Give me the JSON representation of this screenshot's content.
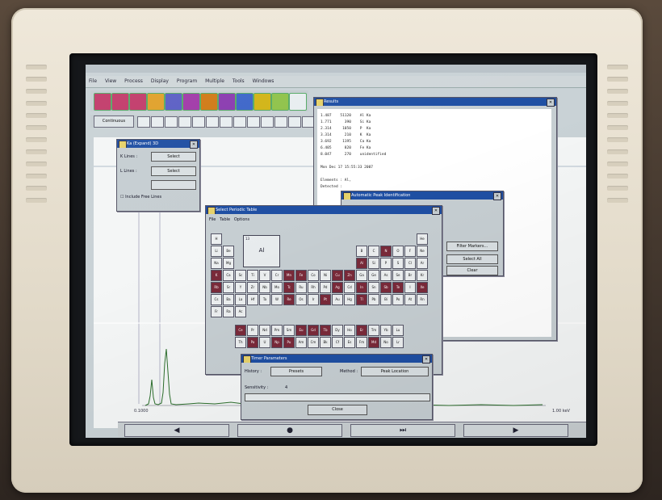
{
  "menu": [
    "File",
    "View",
    "Process",
    "Display",
    "Program",
    "Multiple",
    "Tools",
    "Windows"
  ],
  "toolbar": {
    "button_colors": [
      "#c23b6a",
      "#c23b6a",
      "#c23b6a",
      "#e0a12a",
      "#5b5fc4",
      "#a13aa8",
      "#d07a16",
      "#8a3bb0",
      "#3d66c9",
      "#d2b416",
      "#8fc24a",
      "#e8eef0"
    ],
    "control_label": "Continuous"
  },
  "results": {
    "title": "Results",
    "lines": [
      "1.487    51120    Al Ka",
      "1.771      390    Si Ka",
      "2.314     1050    P  Ka",
      "3.314      210    K  Ka",
      "3.692     1195    Ca Ka",
      "6.405      820    Fe Ka",
      "8.047      270    unidentified",
      "",
      "Mon Dec 17 15:55:33 2007",
      "",
      "Elements : Al,",
      "Detected :"
    ]
  },
  "ka_dialog": {
    "title": "Ka (Expand) 3D",
    "lines_label_1": "K Lines :",
    "lines_label_2": "L Lines :",
    "select_1": "Select",
    "select_2": "Select",
    "checkbox_label": "Include Free Lines"
  },
  "auto_peak": {
    "title": "Automatic Peak Identification",
    "buttons": [
      "Filter Markers...",
      "Select All",
      "Clear"
    ]
  },
  "periodic": {
    "title": "Select Periodic Table",
    "menu": [
      "File",
      "Table",
      "Options"
    ],
    "selected_number": "13",
    "selected_symbol": "Al",
    "elements": [
      "H",
      "He",
      "Li",
      "Be",
      "B",
      "C",
      "N",
      "O",
      "F",
      "Ne",
      "Na",
      "Mg",
      "Al",
      "Si",
      "P",
      "S",
      "Cl",
      "Ar",
      "K",
      "Ca",
      "Sc",
      "Ti",
      "V",
      "Cr",
      "Mn",
      "Fe",
      "Co",
      "Ni",
      "Cu",
      "Zn",
      "Ga",
      "Ge",
      "As",
      "Se",
      "Br",
      "Kr",
      "Rb",
      "Sr",
      "Y",
      "Zr",
      "Nb",
      "Mo",
      "Tc",
      "Ru",
      "Rh",
      "Pd",
      "Ag",
      "Cd",
      "In",
      "Sn",
      "Sb",
      "Te",
      "I",
      "Xe",
      "Cs",
      "Ba",
      "La",
      "Hf",
      "Ta",
      "W",
      "Re",
      "Os",
      "Ir",
      "Pt",
      "Au",
      "Hg",
      "Tl",
      "Pb",
      "Bi",
      "Po",
      "At",
      "Rn",
      "Fr",
      "Ra",
      "Ac",
      "Ce",
      "Pr",
      "Nd",
      "Pm",
      "Sm",
      "Eu",
      "Gd",
      "Tb",
      "Dy",
      "Ho",
      "Er",
      "Tm",
      "Yb",
      "Lu",
      "Th",
      "Pa",
      "U",
      "Np",
      "Pu",
      "Am",
      "Cm",
      "Bk",
      "Cf",
      "Es",
      "Fm",
      "Md",
      "No",
      "Lr"
    ],
    "highlighted": [
      "N",
      "Al",
      "K",
      "Mn",
      "Fe",
      "Cu",
      "Zn",
      "Rb",
      "Tc",
      "Ag",
      "In",
      "Sb",
      "Te",
      "Xe",
      "Re",
      "Pt",
      "Tl",
      "Ce",
      "Eu",
      "Gd",
      "Tb",
      "Er",
      "Pa",
      "Np",
      "Pu",
      "Md"
    ]
  },
  "timer_parameters": {
    "title": "Timer Parameters",
    "history_label": "History :",
    "history_value": "Presets",
    "method_label": "Method :",
    "method_value": "Peak Location",
    "sensitivity_label": "Sensitivity :",
    "sensitivity_value": "4",
    "close_label": "Close"
  },
  "plot": {
    "left_corner": "0.1000",
    "right_corner": "1.00 keV"
  },
  "nav": {
    "buttons": [
      "◀",
      "●",
      "⏭",
      "▶"
    ]
  }
}
